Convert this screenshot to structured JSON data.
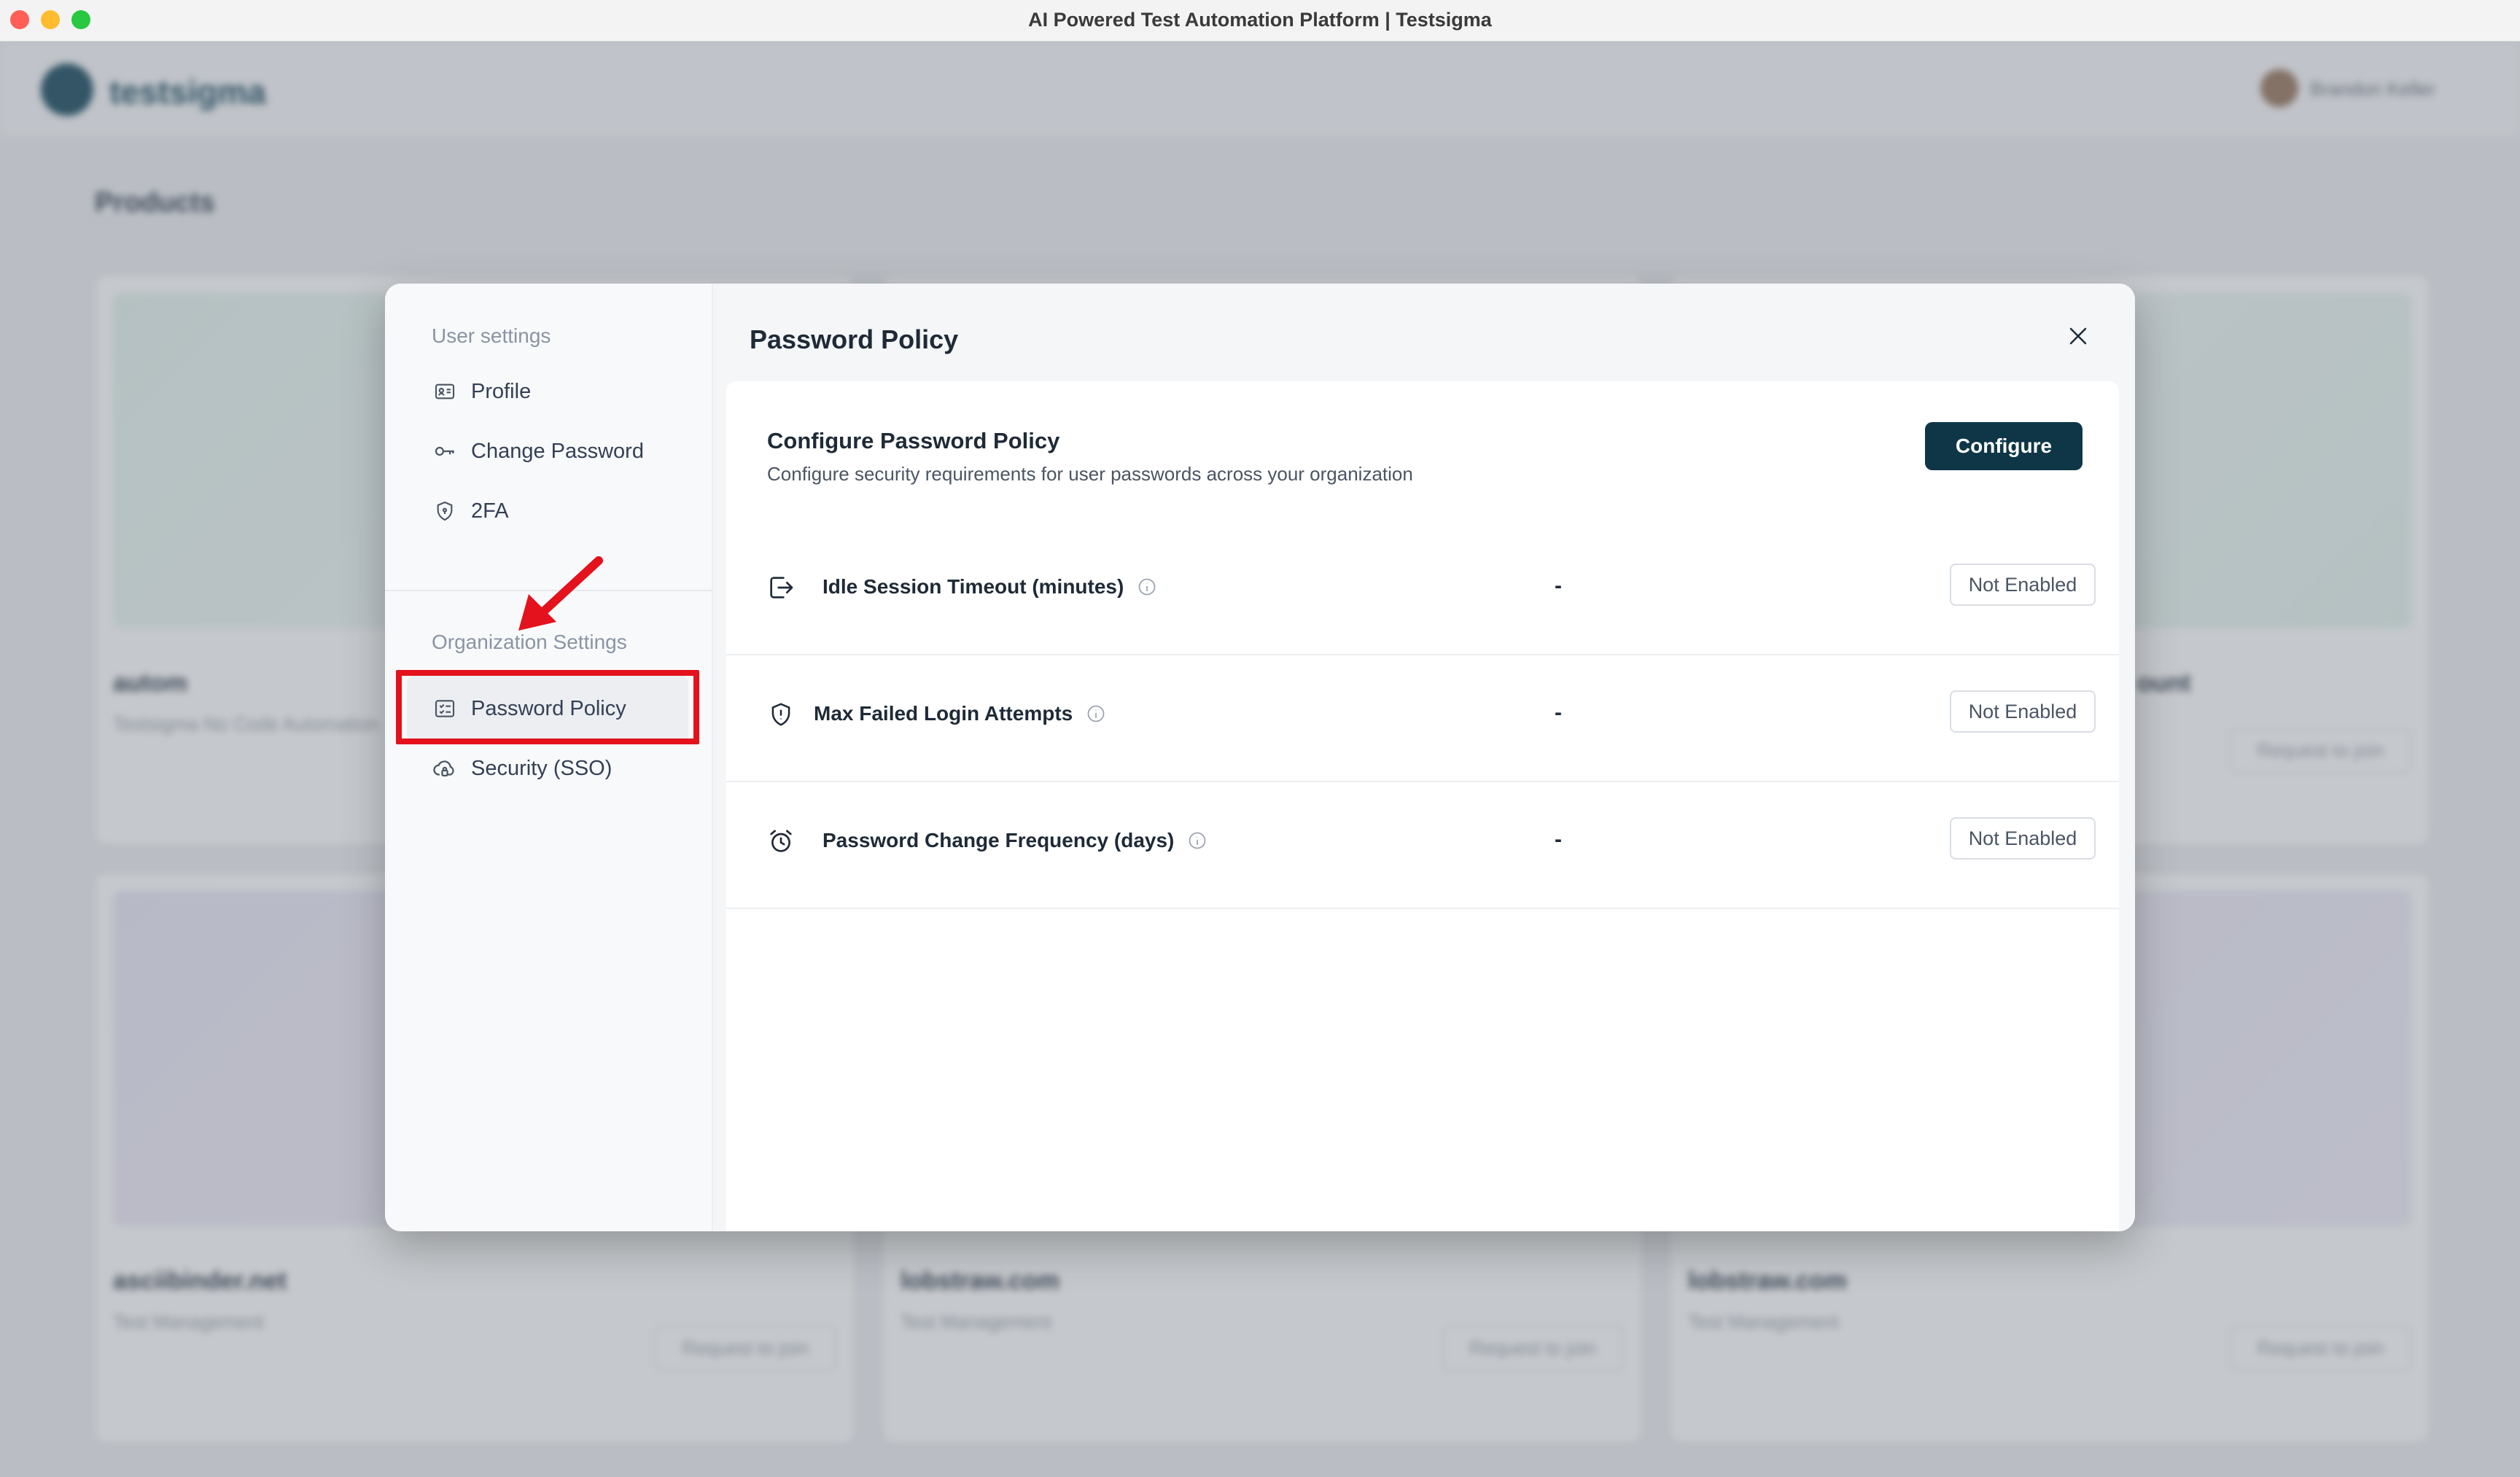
{
  "window": {
    "title": "AI Powered Test Automation Platform | Testsigma"
  },
  "background": {
    "logo_text": "testsigma",
    "user_name": "Brandon Keller",
    "page_heading": "Products",
    "cards": [
      {
        "title": "autom",
        "subtitle": "Testsigma No Code Automation",
        "button": ""
      },
      {
        "title": "",
        "subtitle": "",
        "button": ""
      },
      {
        "title": "ount",
        "subtitle": "",
        "button": "Request to join"
      },
      {
        "title": "asciibinder.net",
        "subtitle": "Test Management",
        "button": "Request to join"
      },
      {
        "title": "lobstraw.com",
        "subtitle": "Test Management",
        "button": "Request to join"
      },
      {
        "title": "lobstraw.com",
        "subtitle": "Test Management",
        "button": "Request to join"
      }
    ]
  },
  "sidebar": {
    "user_section_title": "User settings",
    "user_items": [
      {
        "label": "Profile",
        "icon": "id-card-icon"
      },
      {
        "label": "Change Password",
        "icon": "key-icon"
      },
      {
        "label": "2FA",
        "icon": "shield-icon"
      }
    ],
    "org_section_title": "Organization Settings",
    "org_items": [
      {
        "label": "Password Policy",
        "icon": "policy-icon",
        "active": true
      },
      {
        "label": "Security (SSO)",
        "icon": "cloud-lock-icon",
        "active": false
      }
    ]
  },
  "main": {
    "title": "Password Policy",
    "configure": {
      "title": "Configure Password Policy",
      "description": "Configure security requirements for user passwords across your organization",
      "button": "Configure"
    },
    "rows": [
      {
        "label": "Idle Session Timeout (minutes)",
        "icon": "logout-icon",
        "value": "-",
        "status": "Not Enabled"
      },
      {
        "label": "Max Failed Login Attempts",
        "icon": "shield-icon",
        "value": "-",
        "status": "Not Enabled"
      },
      {
        "label": "Password Change Frequency (days)",
        "icon": "alarm-clock-icon",
        "value": "-",
        "status": "Not Enabled"
      }
    ]
  },
  "colors": {
    "primary_button": "#0e3647",
    "highlight": "#e3121c"
  }
}
